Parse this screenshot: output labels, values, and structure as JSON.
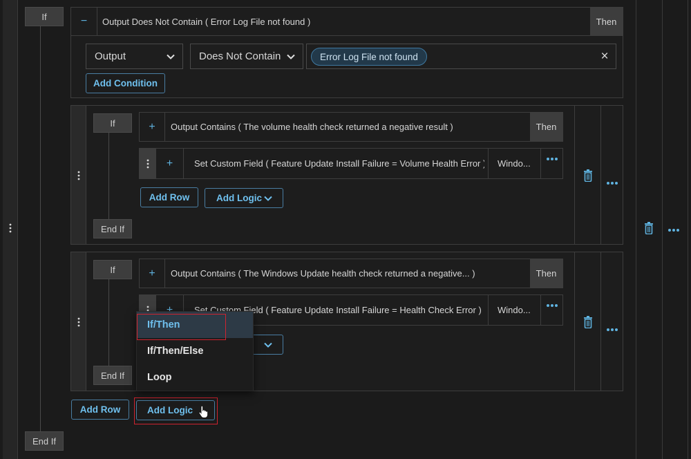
{
  "top_block": {
    "if_label": "If",
    "endif_label": "End If",
    "collapse_sign": "−",
    "condition_summary": "Output Does Not Contain ( Error Log File not found )",
    "then_label": "Then",
    "field_select": "Output",
    "operator_select": "Does Not Contain",
    "value_tag": "Error Log File not found",
    "clear_icon": "×",
    "add_condition_label": "Add Condition"
  },
  "nested_blocks": [
    {
      "if_label": "If",
      "endif_label": "End If",
      "expand_sign": "+",
      "condition_summary": "Output Contains ( The volume health check returned a negative result )",
      "then_label": "Then",
      "row_expand_sign": "+",
      "row_summary": "Set Custom Field ( Feature Update Install Failure = Volume Health Error )",
      "row_target": "Windo...",
      "add_row_label": "Add Row",
      "add_logic_label": "Add Logic"
    },
    {
      "if_label": "If",
      "endif_label": "End If",
      "expand_sign": "+",
      "condition_summary": "Output Contains ( The Windows Update health check returned a negative... )",
      "then_label": "Then",
      "row_expand_sign": "+",
      "row_summary": "Set Custom Field ( Feature Update Install Failure = Health Check Error )",
      "row_target": "Windo...",
      "add_logic_fragment": "c"
    }
  ],
  "bottom_actions": {
    "add_row_label": "Add Row",
    "add_logic_label": "Add Logic"
  },
  "logic_menu": {
    "items": [
      "If/Then",
      "If/Then/Else",
      "Loop"
    ],
    "highlighted": "If/Then"
  },
  "colors": {
    "accent": "#5fb3e0",
    "highlight_outline": "#d0232f",
    "background": "#1b1b1b"
  },
  "icons": [
    "grip-icon",
    "trash-icon",
    "more-icon",
    "chevron-down-icon",
    "close-icon",
    "pointer-hand-icon"
  ]
}
